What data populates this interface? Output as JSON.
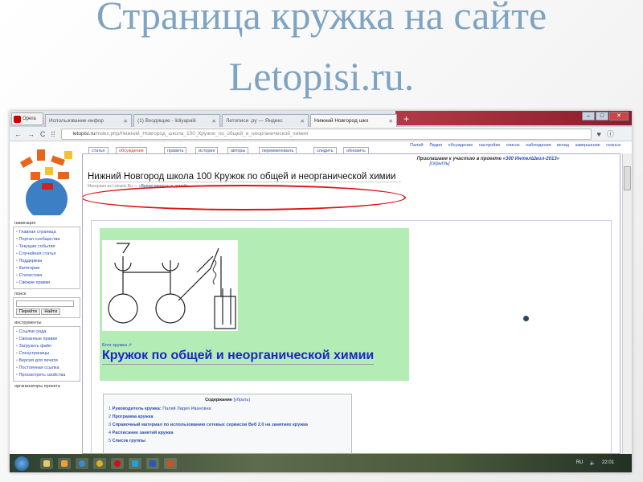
{
  "slide": {
    "title_line1": "Страница кружка на сайте",
    "title_line2": "Letopisi.ru."
  },
  "browser": {
    "app": "Opera",
    "tabs": [
      {
        "label": "Использование инфор"
      },
      {
        "label": "(1) Входящие - lidiyapalii"
      },
      {
        "label": "Летописи .ру — Яндекс"
      },
      {
        "label": "Нижний Новгород шко"
      }
    ],
    "url_domain": "letopisi.ru",
    "url_path": "/index.php/Нижний_Новгород_школа_100_Кружок_по_общей_и_неорганической_химии"
  },
  "page_tabs": [
    "статья",
    "обсуждение",
    "править",
    "история",
    "авторы",
    "переименовать",
    "следить",
    "обновить"
  ],
  "user_links": "Палий Лидия   обсуждение   настройки   список наблюдения   вклад   завершение сеанса",
  "sidebar": {
    "navigation_title": "навигация",
    "navigation": [
      "Главная страница",
      "Портал сообщества",
      "Текущие события",
      "Случайная статья",
      "Поддержка",
      "Категории",
      "Статистика",
      "Свежие правки"
    ],
    "search_title": "поиск",
    "go_button": "Перейти",
    "find_button": "Найти",
    "tools_title": "инструменты",
    "tools": [
      "Ссылки сюда",
      "Связанные правки",
      "Загрузить файл",
      "Спецстраницы",
      "Версия для печати",
      "Постоянная ссылка",
      "Просмотреть свойства"
    ],
    "organizers_title": "организаторы проекта"
  },
  "content": {
    "invite_text": "Приглашаем к участию в проекте ",
    "invite_link": "«300 ИнтелШкол-2013»",
    "hide": "[скрыть]",
    "title": "Нижний Новгород школа 100 Кружок по общей и неорганической химии",
    "subtitle_prefix": "Материал из Letopisi.Ru — ",
    "subtitle_link": "«Время вернуться домой»",
    "blog_link": "Блог кружка ⇗",
    "heading": "Кружок по общей и неорганической химии",
    "toc_title": "Содержание",
    "toc_hide": "[убрать]",
    "toc": [
      {
        "n": "1",
        "text": "Руководитель кружка:",
        "extra": " Палий Лидия Ивановна"
      },
      {
        "n": "2",
        "text": "Программа кружка",
        "extra": ""
      },
      {
        "n": "3",
        "text": "Справочный материал по использованию сетевых сервисов Веб 2.0 на занятиях кружка",
        "extra": ""
      },
      {
        "n": "4",
        "text": "Расписание занятий кружка",
        "extra": ""
      },
      {
        "n": "5",
        "text": "Список группы",
        "extra": ""
      }
    ]
  },
  "taskbar": {
    "lang": "RU",
    "time": "22:01"
  },
  "colors": {
    "title": "#7fa3c2",
    "link": "#2a4bb0",
    "heading": "#1b24c8",
    "green": "#b4ecb6",
    "ellipse": "#dd1111"
  }
}
